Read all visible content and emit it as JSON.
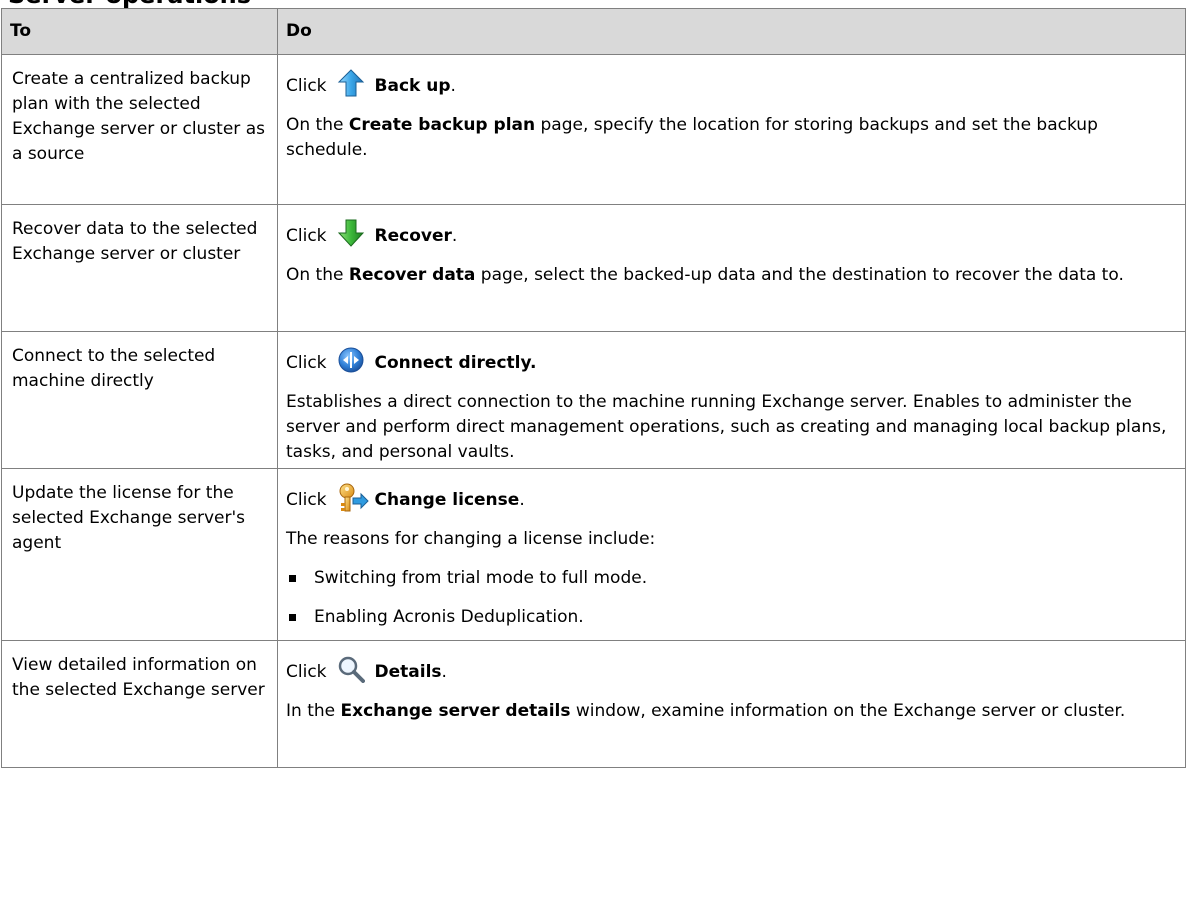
{
  "heading": "Server operations",
  "table": {
    "headers": [
      "To",
      "Do"
    ],
    "rows": [
      {
        "to": "Create a centralized backup plan with the selected Exchange server or cluster as a source",
        "click_word": "Click",
        "icon": "backup-up-arrow-icon",
        "action": "Back up",
        "action_suffix": ".",
        "desc_pre": "On the ",
        "desc_bold": "Create backup plan",
        "desc_post": " page, specify the location for storing backups and set the backup schedule."
      },
      {
        "to": "Recover data to the selected Exchange server or cluster",
        "click_word": "Click",
        "icon": "recover-down-arrow-icon",
        "action": "Recover",
        "action_suffix": ".",
        "desc_pre": "On the ",
        "desc_bold": "Recover data",
        "desc_post": " page, select the backed-up data and the destination to recover the data to."
      },
      {
        "to": "Connect to the selected machine directly",
        "click_word": "Click",
        "icon": "connect-directly-icon",
        "action": "Connect directly.",
        "action_suffix": "",
        "desc_pre": "Establishes a direct connection to the machine running Exchange server. Enables to administer the server and perform direct management operations, such as creating and managing local backup plans, tasks, and personal vaults.",
        "desc_bold": "",
        "desc_post": ""
      },
      {
        "to": "Update the license for the selected Exchange server's agent",
        "click_word": "Click",
        "icon": "change-license-key-icon",
        "action": "Change license",
        "action_suffix": ".",
        "desc_pre": "The reasons for changing a license include:",
        "desc_bold": "",
        "desc_post": "",
        "bullets": [
          "Switching from trial mode to full mode.",
          "Enabling Acronis Deduplication."
        ]
      },
      {
        "to": "View detailed information on the selected Exchange server",
        "click_word": "Click",
        "icon": "details-magnifier-icon",
        "action": "Details",
        "action_suffix": ".",
        "desc_pre": "In the ",
        "desc_bold": "Exchange server details",
        "desc_post": " window, examine information on the Exchange server or cluster."
      }
    ]
  }
}
